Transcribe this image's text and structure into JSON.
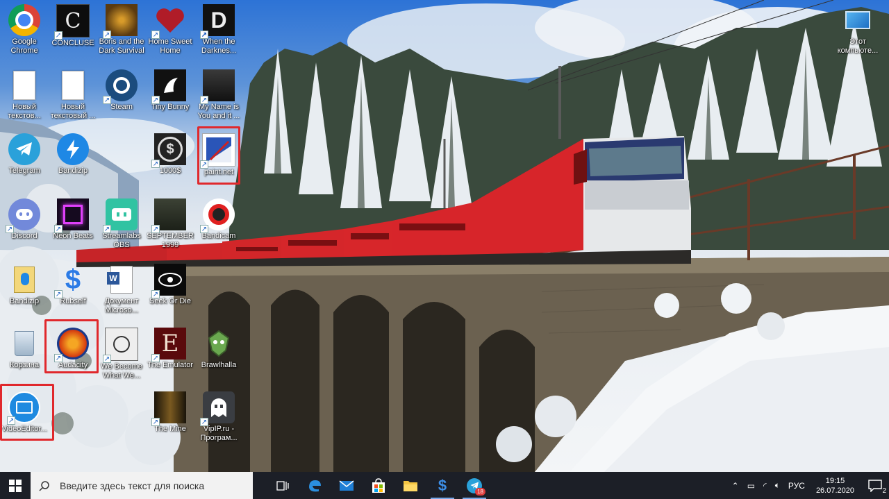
{
  "desktop": {
    "icons": [
      {
        "id": "chrome",
        "label": "Google Chrome"
      },
      {
        "id": "conclusion",
        "label": "CONCLUSE"
      },
      {
        "id": "boris",
        "label": "Boris and the Dark Survival"
      },
      {
        "id": "homesweet",
        "label": "Home Sweet Home"
      },
      {
        "id": "whendark",
        "label": "When the Darknes..."
      },
      {
        "id": "newtext1",
        "label": "Новый текстов..."
      },
      {
        "id": "newtext2",
        "label": "Новый текстовый ..."
      },
      {
        "id": "steam",
        "label": "Steam"
      },
      {
        "id": "tinybunny",
        "label": "Tiny Bunny"
      },
      {
        "id": "mynameis",
        "label": "My Name is You and it ..."
      },
      {
        "id": "game1000",
        "label": "1000$"
      },
      {
        "id": "paintnet",
        "label": "paint.net"
      },
      {
        "id": "telegram",
        "label": "Telegram"
      },
      {
        "id": "bandizip1",
        "label": "Bandizip"
      },
      {
        "id": "discord",
        "label": "Discord"
      },
      {
        "id": "neonbeats",
        "label": "Neon Beats"
      },
      {
        "id": "streamlabs",
        "label": "Streamlabs OBS"
      },
      {
        "id": "september",
        "label": "SEPTEMBER 1999"
      },
      {
        "id": "bandicam",
        "label": "Bandicam"
      },
      {
        "id": "bandizip2",
        "label": "Bandizip"
      },
      {
        "id": "rubself",
        "label": "Rubself"
      },
      {
        "id": "worddoc",
        "label": "Документ Microso..."
      },
      {
        "id": "seekordie",
        "label": "Seek Or Die"
      },
      {
        "id": "recycle",
        "label": "Корзина"
      },
      {
        "id": "audacity",
        "label": "Audacity"
      },
      {
        "id": "webecome",
        "label": "We Become What We..."
      },
      {
        "id": "emulator",
        "label": "The Emulator"
      },
      {
        "id": "brawlhalla",
        "label": "Brawlhalla"
      },
      {
        "id": "videoeditor",
        "label": "VideoEditor..."
      },
      {
        "id": "themine",
        "label": "The Mine"
      },
      {
        "id": "vipip",
        "label": "VipIP.ru - Програм..."
      },
      {
        "id": "thispc",
        "label": "Этот компьюте..."
      }
    ]
  },
  "taskbar": {
    "search_placeholder": "Введите здесь текст для поиска",
    "language": "РУС",
    "time": "19:15",
    "date": "26.07.2020",
    "notification_count": "2",
    "telegram_badge": "18"
  },
  "colors": {
    "taskbar_bg": "#1c1f27",
    "highlight_red": "#e0282c",
    "train_red": "#d7252a"
  }
}
